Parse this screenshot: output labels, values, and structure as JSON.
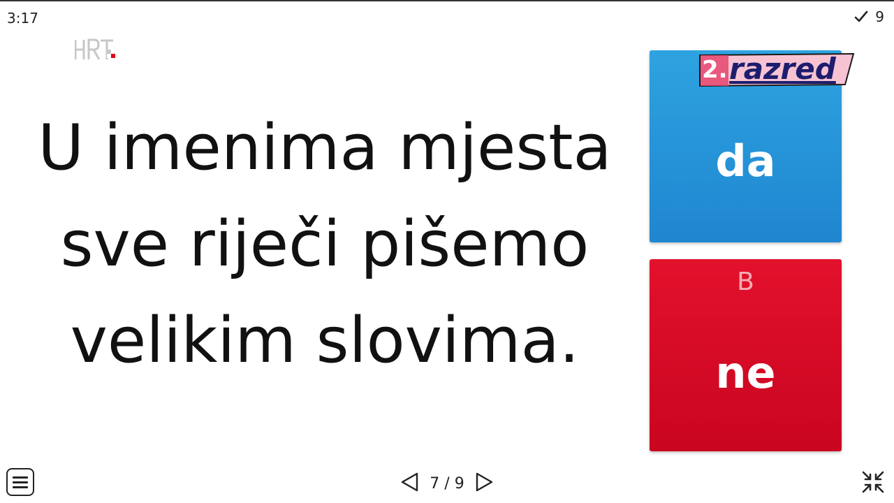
{
  "header": {
    "timer": "3:17",
    "score": "9"
  },
  "question": {
    "text": "U imenima mjesta sve riječi pišemo velikim slovima."
  },
  "answers": [
    {
      "letter": "",
      "label": "da",
      "color": "#1f86d0"
    },
    {
      "letter": "B",
      "label": "ne",
      "color": "#d80a25"
    }
  ],
  "overlay": {
    "grade_number": "2.",
    "grade_text": "razred"
  },
  "footer": {
    "pagination": "7 / 9"
  },
  "icons": {
    "logo": "hrt-logo",
    "score": "checkmark-icon",
    "menu": "menu-icon",
    "prev": "previous-triangle-icon",
    "next": "next-triangle-icon",
    "fullscreen": "exit-fullscreen-icon"
  }
}
